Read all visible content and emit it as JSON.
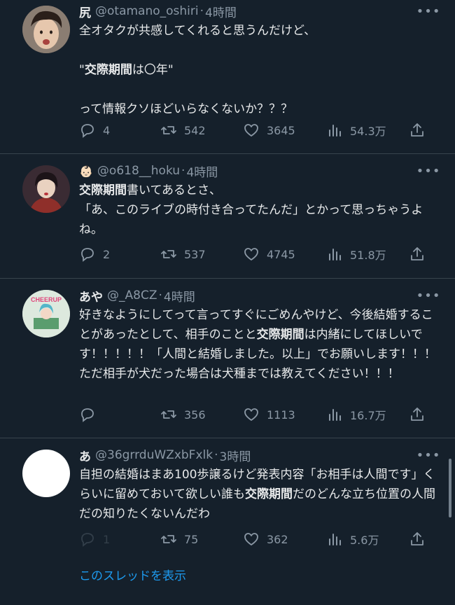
{
  "tweets": [
    {
      "display_name": "尻",
      "handle": "@otamano_oshiri",
      "time": "4時間",
      "segments": [
        {
          "t": "全オタクが共感してくれると思うんだけど、\n\n\"",
          "b": false
        },
        {
          "t": "交際期間",
          "b": true
        },
        {
          "t": "は〇年\"\n\nって情報クソほどいらなくないか？？？",
          "b": false
        }
      ],
      "stats": {
        "reply": "4",
        "retweet": "542",
        "like": "3645",
        "views": "54.3万"
      }
    },
    {
      "display_name": "👶🏻",
      "handle": "@o618__hoku",
      "time": "4時間",
      "segments": [
        {
          "t": "交際期間",
          "b": true
        },
        {
          "t": "書いてあるとさ、\n「あ、このライブの時付き合ってたんだ」とかって思っちゃうよね。",
          "b": false
        }
      ],
      "stats": {
        "reply": "2",
        "retweet": "537",
        "like": "4745",
        "views": "51.8万"
      }
    },
    {
      "display_name": "あや",
      "handle": "@_A8CZ",
      "time": "4時間",
      "avatar_text": "CHEERUP",
      "segments": [
        {
          "t": "好きなようにしてって言ってすぐにごめんやけど、今後結婚することがあったとして、相手のことと",
          "b": false
        },
        {
          "t": "交際期間",
          "b": true
        },
        {
          "t": "は内緒にしてほしいです！！！！！「人間と結婚しました。以上」でお願いします！！！ただ相手が犬だった場合は犬種までは教えてください！！！",
          "b": false
        }
      ],
      "stats": {
        "reply": "",
        "retweet": "356",
        "like": "1113",
        "views": "16.7万"
      }
    },
    {
      "display_name": "あ",
      "handle": "@36grrduWZxbFxlk",
      "time": "3時間",
      "segments": [
        {
          "t": "自担の結婚はまあ100歩譲るけど発表内容「お相手は人間です」くらいに留めておいて欲しい誰も",
          "b": false
        },
        {
          "t": "交際期間",
          "b": true
        },
        {
          "t": "だのどんな立ち位置の人間だの知りたくないんだわ",
          "b": false
        }
      ],
      "stats": {
        "reply": "1",
        "retweet": "75",
        "like": "362",
        "views": "5.6万"
      }
    }
  ],
  "show_thread": "このスレッドを表示",
  "icons": [
    "reply-icon",
    "retweet-icon",
    "like-icon",
    "views-icon",
    "share-icon",
    "more-icon"
  ],
  "colors": {
    "background": "#15202b",
    "text": "#e7e9ea",
    "muted": "#8b98a5",
    "link": "#1d9bf0",
    "divider": "#38444d"
  }
}
